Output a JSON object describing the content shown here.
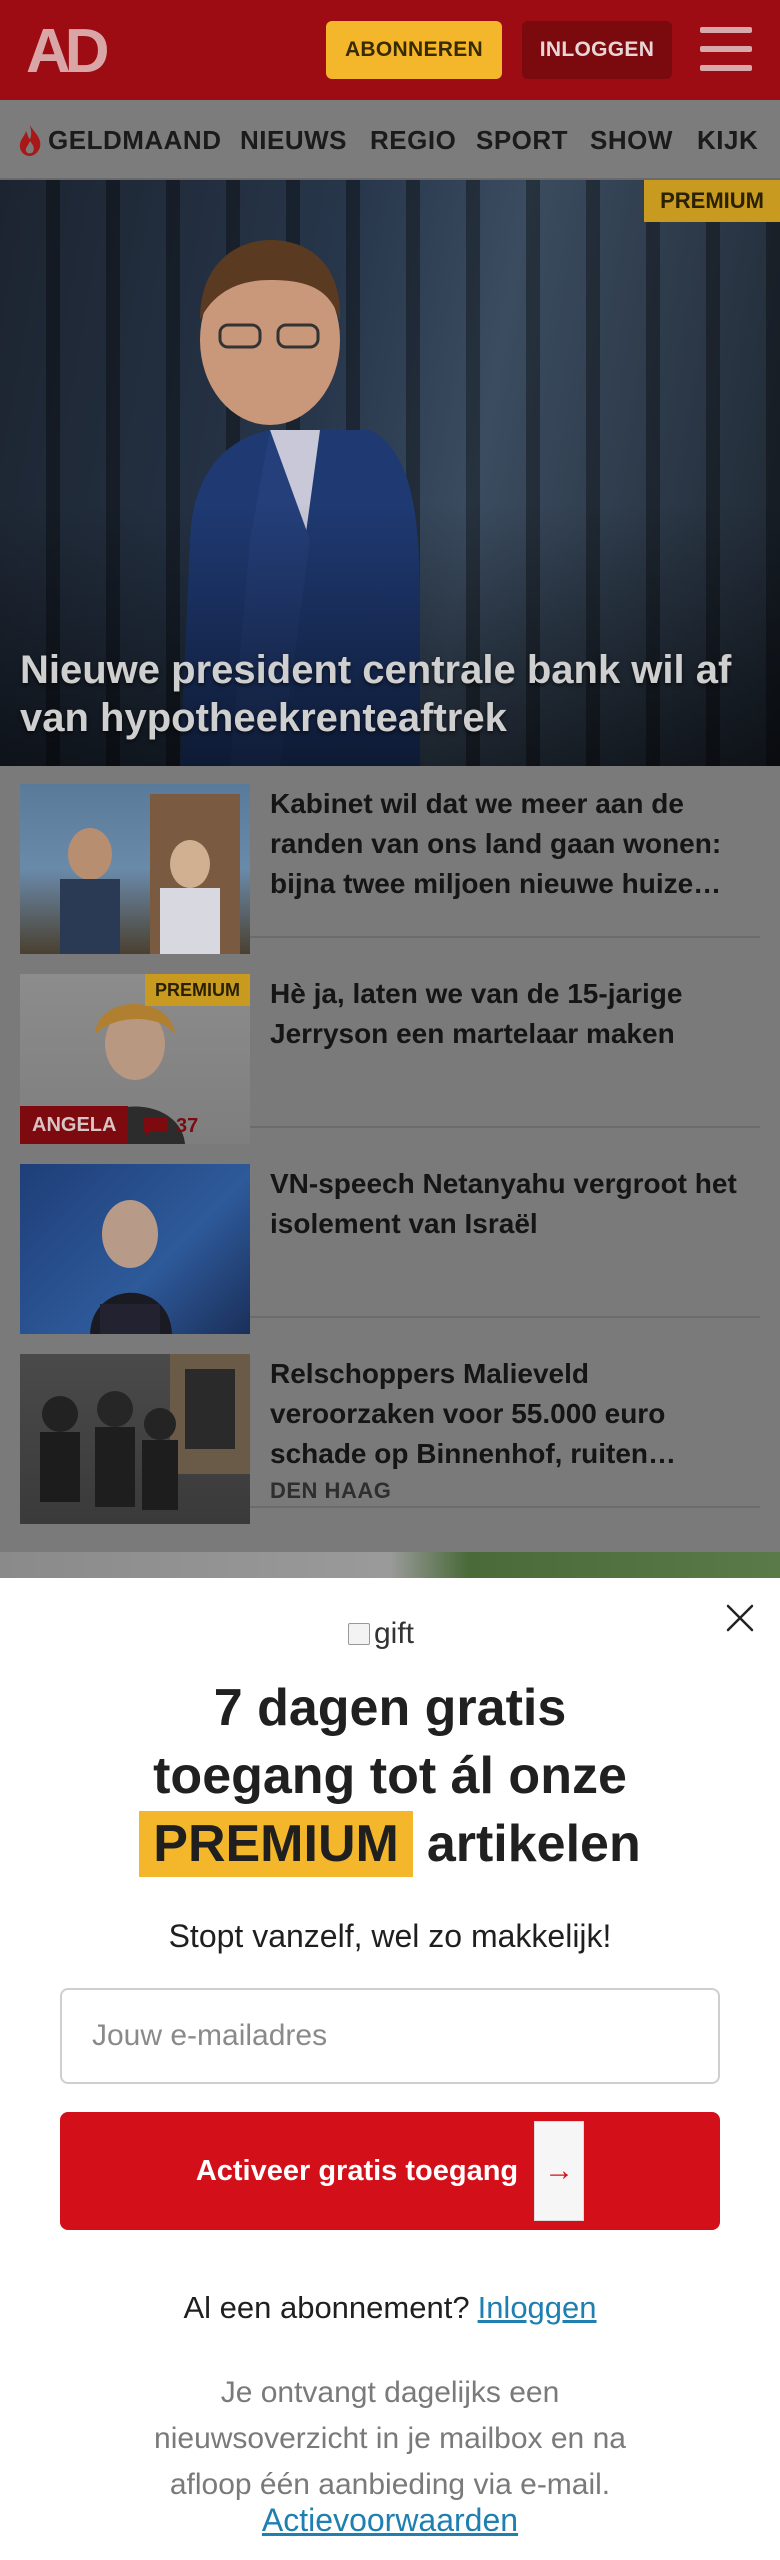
{
  "header": {
    "logo_text": "AD",
    "subscribe_label": "ABONNEREN",
    "login_label": "INLOGGEN",
    "menu_icon": "hamburger-icon",
    "brand_color": "#c8101b",
    "accent_color": "#f4b72c"
  },
  "nav": {
    "items": [
      {
        "label": "GELDMAAND",
        "icon": "flame-icon"
      },
      {
        "label": "NIEUWS"
      },
      {
        "label": "REGIO"
      },
      {
        "label": "SPORT"
      },
      {
        "label": "SHOW"
      },
      {
        "label": "KIJK"
      }
    ]
  },
  "hero": {
    "badge": "PREMIUM",
    "title": "Nieuwe president centrale bank wil af van hypotheekrenteaftrek"
  },
  "articles": [
    {
      "title": "Kabinet wil dat we meer aan de randen van ons land gaan wonen: bijna twee miljoen nieuwe huize…"
    },
    {
      "title": "Hè ja, laten we van de 15-jarige Jerryson een martelaar maken",
      "badge": "PREMIUM",
      "author": "ANGELA",
      "comments": "37"
    },
    {
      "title": "VN-speech Netanyahu vergroot het isolement van Israël"
    },
    {
      "title": "Relschoppers Malieveld veroorzaken voor 55.000 euro schade op Binnenhof, ruiten…",
      "region": "DEN HAAG"
    }
  ],
  "modal": {
    "gift_alt": "gift",
    "headline_line1": "7 dagen gratis",
    "headline_line2": "toegang tot ál onze",
    "headline_premium": "PREMIUM",
    "headline_tail": "artikelen",
    "subline": "Stopt vanzelf, wel zo makkelijk!",
    "email_placeholder": "Jouw e-mailadres",
    "cta_label": "Activeer gratis toegang",
    "cta_icon_alt": "arrow-right",
    "already_text": "Al een abonnement?",
    "already_link": "Inloggen",
    "info_text": "Je ontvangt dagelijks een nieuwsoverzicht in je mailbox en na afloop één aanbieding via e-mail.",
    "terms_link": "Actievoorwaarden"
  }
}
